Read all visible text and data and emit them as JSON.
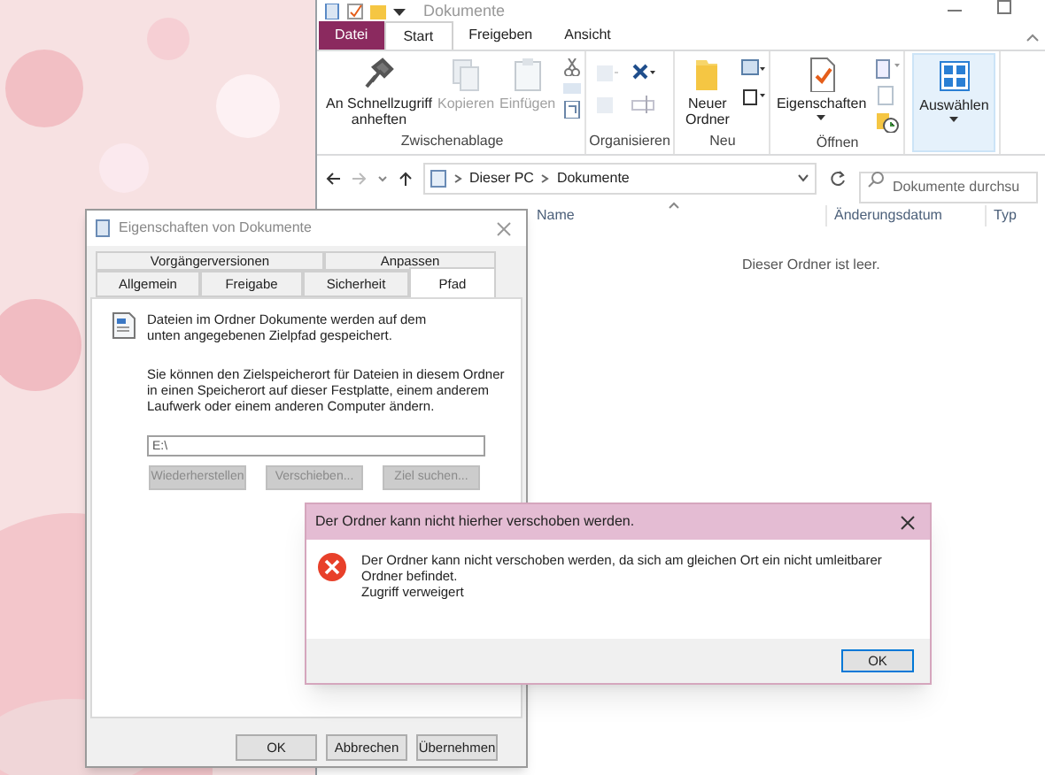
{
  "explorer": {
    "title": "Dokumente",
    "ribbon_tabs": [
      {
        "label": "Datei",
        "kind": "file",
        "selected": false
      },
      {
        "label": "Start",
        "kind": "tab",
        "selected": true
      },
      {
        "label": "Freigeben",
        "kind": "tab",
        "selected": false
      },
      {
        "label": "Ansicht",
        "kind": "tab",
        "selected": false
      }
    ],
    "ribbon_groups": [
      {
        "label": "Zwischenablage",
        "commands": [
          {
            "label": "An Schnellzugriff anheften",
            "disabled": false
          },
          {
            "label": "Kopieren",
            "disabled": true
          },
          {
            "label": "Einfügen",
            "disabled": true
          }
        ]
      },
      {
        "label": "Organisieren"
      },
      {
        "label": "Neu",
        "commands": [
          {
            "label": "Neuer Ordner",
            "disabled": false
          }
        ]
      },
      {
        "label": "Öffnen",
        "commands": [
          {
            "label": "Eigenschaften",
            "disabled": false,
            "dropdown": true
          }
        ]
      },
      {
        "commands": [
          {
            "label": "Auswählen",
            "disabled": false,
            "dropdown": true,
            "hovered": true
          }
        ]
      }
    ],
    "breadcrumb": [
      "Dieser PC",
      "Dokumente"
    ],
    "search": {
      "placeholder": "Dokumente durchsu"
    },
    "columns": [
      "Name",
      "Änderungsdatum",
      "Typ"
    ],
    "empty_message": "Dieser Ordner ist leer."
  },
  "properties_dialog": {
    "title": "Eigenschaften von Dokumente",
    "tabs_back": [
      {
        "label": "Vorgängerversionen",
        "selected": false
      },
      {
        "label": "Anpassen",
        "selected": false
      }
    ],
    "tabs_front": [
      {
        "label": "Allgemein",
        "selected": false
      },
      {
        "label": "Freigabe",
        "selected": false
      },
      {
        "label": "Sicherheit",
        "selected": false
      },
      {
        "label": "Pfad",
        "selected": true
      }
    ],
    "description": "Dateien im Ordner Dokumente werden auf dem unten angegebenen Zielpfad gespeichert.",
    "instructions": "Sie können den Zielspeicherort für Dateien in diesem Ordner in einen Speicherort auf dieser Festplatte, einem anderem Laufwerk oder einem anderen Computer ändern.",
    "path_value": "E:\\",
    "path_buttons": [
      {
        "label": "Wiederherstellen",
        "disabled": true
      },
      {
        "label": "Verschieben...",
        "disabled": true
      },
      {
        "label": "Ziel suchen...",
        "disabled": true
      }
    ],
    "buttons": [
      {
        "label": "OK",
        "disabled": false
      },
      {
        "label": "Abbrechen",
        "disabled": false
      },
      {
        "label": "Übernehmen",
        "disabled": false
      }
    ]
  },
  "error_dialog": {
    "title": "Der Ordner kann nicht hierher verschoben werden.",
    "message": "Der Ordner kann nicht verschoben werden, da sich am gleichen Ort ein nicht umleitbarer Ordner befindet.",
    "detail": "Zugriff verweigert",
    "button": "OK"
  }
}
